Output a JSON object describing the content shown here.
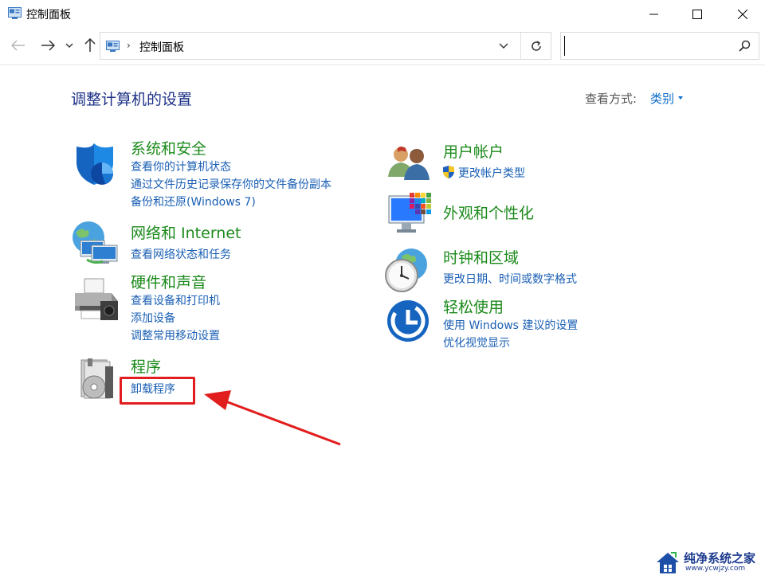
{
  "window": {
    "title": "控制面板"
  },
  "address": {
    "breadcrumb": "控制面板",
    "separator": "›"
  },
  "search": {
    "value": "",
    "placeholder": ""
  },
  "main": {
    "heading": "调整计算机的设置",
    "view_by_label": "查看方式:",
    "view_by_value": "类别"
  },
  "categories": {
    "system": {
      "title": "系统和安全",
      "icon": "shield-icon",
      "links": [
        "查看你的计算机状态",
        "通过文件历史记录保存你的文件备份副本",
        "备份和还原(Windows 7)"
      ]
    },
    "network": {
      "title": "网络和 Internet",
      "icon": "network-globe-icon",
      "links": [
        "查看网络状态和任务"
      ]
    },
    "hardware": {
      "title": "硬件和声音",
      "icon": "printer-icon",
      "links": [
        "查看设备和打印机",
        "添加设备",
        "调整常用移动设置"
      ]
    },
    "programs": {
      "title": "程序",
      "icon": "programs-disc-icon",
      "links": [
        "卸载程序"
      ]
    },
    "users": {
      "title": "用户帐户",
      "icon": "users-icon",
      "links": [
        "更改帐户类型"
      ]
    },
    "appearance": {
      "title": "外观和个性化",
      "icon": "monitor-palette-icon",
      "links": []
    },
    "clock": {
      "title": "时钟和区域",
      "icon": "clock-globe-icon",
      "links": [
        "更改日期、时间或数字格式"
      ]
    },
    "ease": {
      "title": "轻松使用",
      "icon": "ease-of-access-icon",
      "links": [
        "使用 Windows 建议的设置",
        "优化视觉显示"
      ]
    }
  },
  "watermark": {
    "name": "纯净系统之家",
    "url": "www.ycwjzy.com"
  },
  "colors": {
    "category_title": "#1b8a1b",
    "link": "#1a5fb4",
    "heading": "#1e3287",
    "annotation": "#e21d1d"
  }
}
